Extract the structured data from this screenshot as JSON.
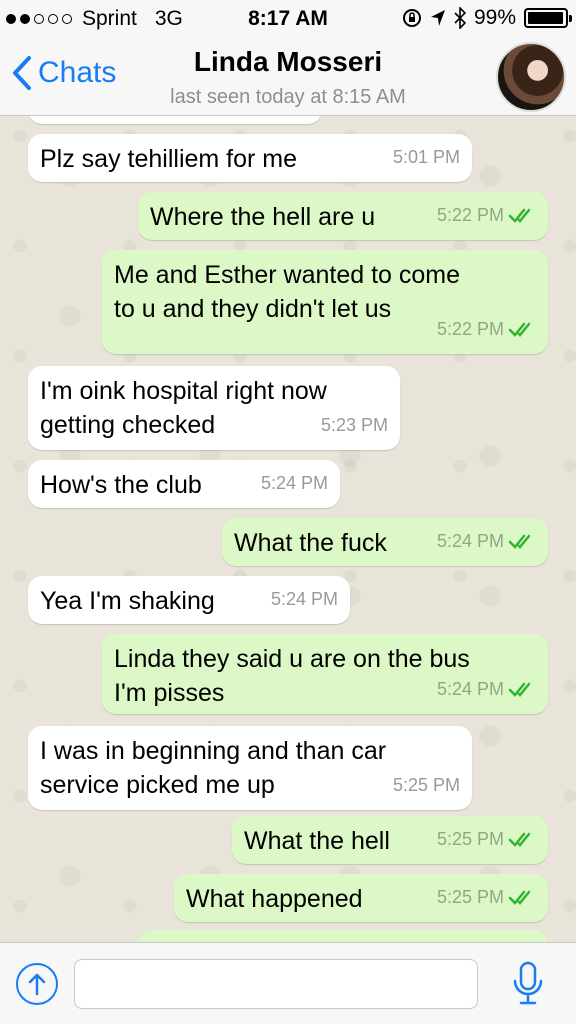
{
  "status_bar": {
    "carrier": "Sprint",
    "network": "3G",
    "time": "8:17 AM",
    "battery": "99%"
  },
  "nav": {
    "back_label": "Chats",
    "contact_name": "Linda Mosseri",
    "last_seen": "last seen today at 8:15 AM"
  },
  "messages": [
    {
      "dir": "in",
      "text": "Plz say tehilliem for me",
      "time": "5:01 PM"
    },
    {
      "dir": "out",
      "text": "Where the hell are u",
      "time": "5:22 PM"
    },
    {
      "dir": "out",
      "text": "Me and Esther wanted to come\nto u and they didn't let us",
      "time": "5:22 PM"
    },
    {
      "dir": "in",
      "text": "I'm oink hospital right now\ngetting checked",
      "time": "5:23 PM"
    },
    {
      "dir": "in",
      "text": "How's the club",
      "time": "5:24 PM"
    },
    {
      "dir": "out",
      "text": "What the fuck",
      "time": "5:24 PM"
    },
    {
      "dir": "in",
      "text": "Yea I'm shaking",
      "time": "5:24 PM"
    },
    {
      "dir": "out",
      "text": "Linda they said u are on the bus\nI'm pisses",
      "time": "5:24 PM"
    },
    {
      "dir": "in",
      "text": "I was in beginning and than car\nservice picked me up",
      "time": "5:25 PM"
    },
    {
      "dir": "out",
      "text": "What the hell",
      "time": "5:25 PM"
    },
    {
      "dir": "out",
      "text": "What happened",
      "time": "5:25 PM"
    }
  ],
  "input": {
    "placeholder": "",
    "value": ""
  },
  "colors": {
    "accent": "#1a7cf5",
    "outgoing_bubble": "#dcf8c6",
    "incoming_bubble": "#ffffff",
    "read_ticks": "#34b233"
  }
}
